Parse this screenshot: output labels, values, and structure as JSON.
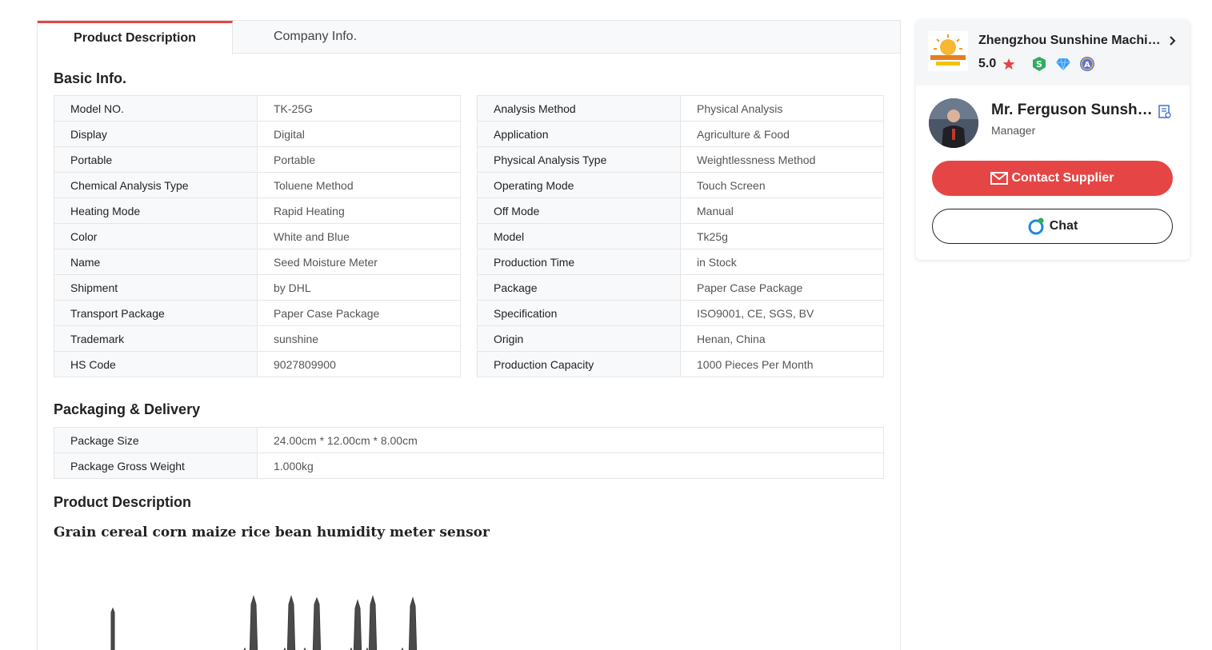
{
  "tabs": {
    "product_description": "Product Description",
    "company_info": "Company Info."
  },
  "basic_info": {
    "title": "Basic Info.",
    "left": [
      {
        "key": "Model NO.",
        "value": "TK-25G"
      },
      {
        "key": "Display",
        "value": "Digital"
      },
      {
        "key": "Portable",
        "value": "Portable"
      },
      {
        "key": "Chemical Analysis Type",
        "value": "Toluene Method"
      },
      {
        "key": "Heating Mode",
        "value": "Rapid Heating"
      },
      {
        "key": "Color",
        "value": "White and Blue"
      },
      {
        "key": "Name",
        "value": "Seed Moisture Meter"
      },
      {
        "key": "Shipment",
        "value": "by DHL"
      },
      {
        "key": "Transport Package",
        "value": "Paper Case Package"
      },
      {
        "key": "Trademark",
        "value": "sunshine"
      },
      {
        "key": "HS Code",
        "value": "9027809900"
      }
    ],
    "right": [
      {
        "key": "Analysis Method",
        "value": "Physical Analysis"
      },
      {
        "key": "Application",
        "value": "Agriculture & Food"
      },
      {
        "key": "Physical Analysis Type",
        "value": "Weightlessness Method"
      },
      {
        "key": "Operating Mode",
        "value": "Touch Screen"
      },
      {
        "key": "Off Mode",
        "value": "Manual"
      },
      {
        "key": "Model",
        "value": "Tk25g"
      },
      {
        "key": "Production Time",
        "value": "in Stock"
      },
      {
        "key": "Package",
        "value": "Paper Case Package"
      },
      {
        "key": "Specification",
        "value": "ISO9001, CE, SGS, BV"
      },
      {
        "key": "Origin",
        "value": "Henan, China"
      },
      {
        "key": "Production Capacity",
        "value": "1000 Pieces Per Month"
      }
    ]
  },
  "packaging": {
    "title": "Packaging & Delivery",
    "rows": [
      {
        "key": "Package Size",
        "value": "24.00cm * 12.00cm * 8.00cm"
      },
      {
        "key": "Package Gross Weight",
        "value": "1.000kg"
      }
    ]
  },
  "product_description": {
    "title": "Product Description",
    "heading": "Grain cereal corn maize rice bean humidity meter sensor"
  },
  "supplier": {
    "company_name": "Zhengzhou Sunshine Machinery Co., Ltd.",
    "rating": "5.0",
    "contact_name": "Mr. Ferguson Sunshine",
    "contact_title": "Manager",
    "contact_button": "Contact Supplier",
    "chat_button": "Chat",
    "icons": {
      "badges": [
        "shield-s-icon",
        "diamond-icon",
        "audited-a-icon"
      ]
    }
  },
  "colors": {
    "accent_red": "#e64545",
    "star_red": "#e64545",
    "badge_green": "#2dae5e",
    "badge_blue": "#3d9bf0",
    "badge_navy": "#5a74d6"
  }
}
